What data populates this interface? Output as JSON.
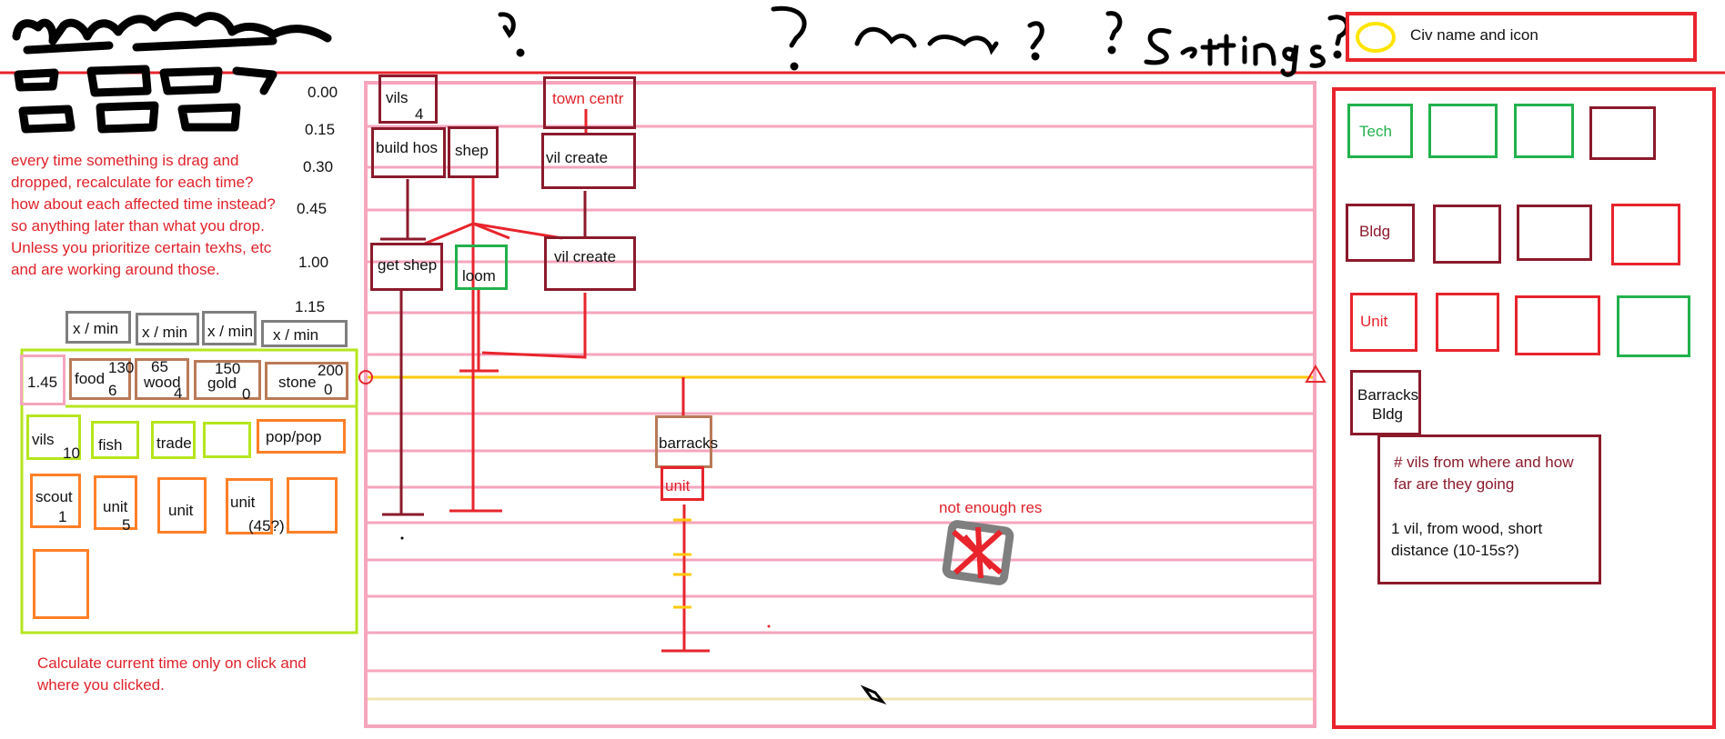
{
  "header": {
    "scribbles": [
      "?",
      "?",
      "map",
      "?",
      "?",
      "Settings?"
    ],
    "civ_box": {
      "label": "Civ name and icon",
      "icon": "circle-icon",
      "icon_color": "#ffe400"
    }
  },
  "resources_rates": [
    "x / min",
    "x / min",
    "x / min",
    "x / min"
  ],
  "resources": {
    "current_time": "1.45",
    "items": [
      {
        "name": "food",
        "top": "130",
        "bottom": "6"
      },
      {
        "name": "wood",
        "top": "65",
        "bottom": "4"
      },
      {
        "name": "gold",
        "top": "150",
        "bottom": "0"
      },
      {
        "name": "stone",
        "top": "200",
        "bottom": "0"
      }
    ]
  },
  "population": {
    "vils_label": "vils",
    "vils_count": "10",
    "fish": "fish",
    "trade": "trade",
    "pop": "pop/pop",
    "scout": "scout",
    "scout_count": "1",
    "unit1": "unit",
    "unit1_count": "5",
    "unit2": "unit",
    "unit3": "unit",
    "unit3_count": "(45?)"
  },
  "notes": {
    "drag_drop": "every time something is drag and dropped, recalculate for each time? how about each affected time instead? so anything later than what you drop. Unless you prioritize certain texhs, etc and are working around those.",
    "calculate": "Calculate current time only on click and where you clicked.",
    "not_enough": "not enough res",
    "vils_from": "# vils from where and how far are they going",
    "vils_detail": "1 vil, from wood, short distance (10-15s?)"
  },
  "timeline": {
    "times": [
      "0.00",
      "0.15",
      "0.30",
      "0.45",
      "1.00",
      "1.15"
    ],
    "tasks": {
      "vils": "vils",
      "vils_count": "4",
      "build_house": "build hos",
      "shep": "shep",
      "town_center": "town centr",
      "vil_create1": "vil create",
      "get_shep": "get shep",
      "loom": "loom",
      "vil_create2": "vil create",
      "barracks": "barracks",
      "unit": "unit"
    }
  },
  "palette": {
    "tech": "Tech",
    "bldg": "Bldg",
    "unit": "Unit",
    "barracks": "Barracks Bldg"
  },
  "colors": {
    "red": "#e8242c",
    "maroon": "#8b1a2b",
    "green": "#22b14c",
    "pink": "#f6a5bd",
    "orange": "#ff7f27",
    "lime": "#b5e61d",
    "brown": "#b97a57",
    "grey": "#7f7f7f",
    "yellow": "#ffc90e"
  }
}
